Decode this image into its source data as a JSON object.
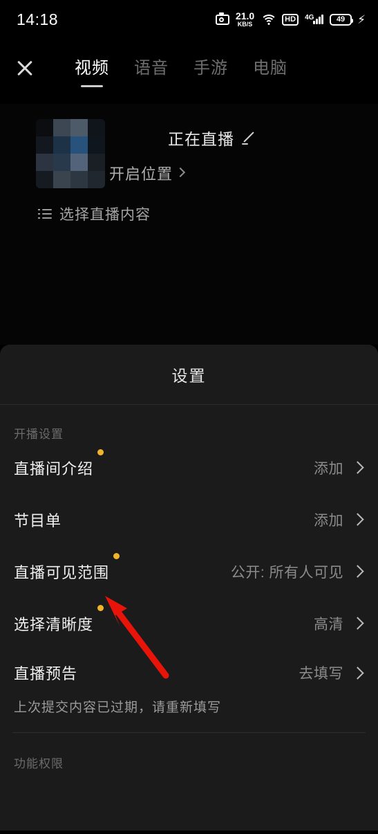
{
  "statusbar": {
    "time": "14:18",
    "camera_icon": "camera-icon",
    "net_speed_value": "21.0",
    "net_speed_unit": "KB/S",
    "wifi_icon": "wifi-icon",
    "hd_label": "HD",
    "network_type": "4G",
    "battery_level": "49",
    "charging_icon": "⚡"
  },
  "topbar": {
    "close_icon": "close-icon",
    "tabs": [
      {
        "label": "视频",
        "active": true
      },
      {
        "label": "语音",
        "active": false
      },
      {
        "label": "手游",
        "active": false
      },
      {
        "label": "电脑",
        "active": false
      }
    ]
  },
  "preview": {
    "cover_alt": "live-cover-thumbnail",
    "room_title": "正在直播",
    "edit_icon": "pencil-icon",
    "location_label": "开启位置",
    "location_chevron": "chevron-right-icon",
    "content_icon": "list-icon",
    "content_label": "选择直播内容"
  },
  "sheet": {
    "title": "设置",
    "section_broadcast": "开播设置",
    "section_permissions": "功能权限",
    "rows": [
      {
        "label": "直播间介绍",
        "badge": true,
        "value": "添加",
        "chevron": "chevron-right-icon",
        "sub": ""
      },
      {
        "label": "节目单",
        "badge": false,
        "value": "添加",
        "chevron": "chevron-right-icon",
        "sub": ""
      },
      {
        "label": "直播可见范围",
        "badge": true,
        "value": "公开: 所有人可见",
        "chevron": "chevron-right-icon",
        "sub": ""
      },
      {
        "label": "选择清晰度",
        "badge": true,
        "value": "高清",
        "chevron": "chevron-right-icon",
        "sub": ""
      },
      {
        "label": "直播预告",
        "badge": false,
        "value": "去填写",
        "chevron": "chevron-right-icon",
        "sub": "上次提交内容已过期，请重新填写"
      }
    ]
  },
  "annotation": {
    "arrow_color": "#e8140a",
    "arrow_target": "直播可见范围"
  },
  "colors": {
    "background": "#000000",
    "sheet_background": "#1b1b1b",
    "badge_dot": "#f0b42a",
    "active_tab": "#ffffff",
    "inactive_tab": "#6e6e6e",
    "value_text": "#8b8b8b"
  }
}
